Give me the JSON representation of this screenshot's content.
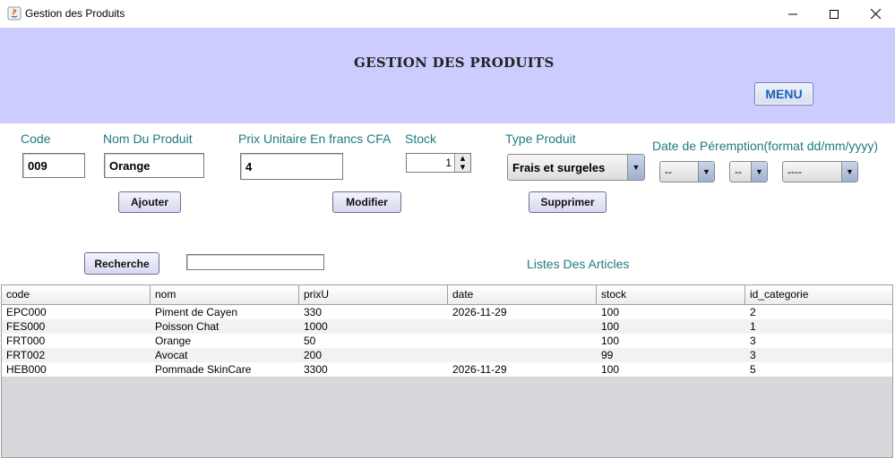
{
  "window": {
    "title": "Gestion des Produits",
    "controls": [
      "minimize",
      "maximize",
      "close"
    ]
  },
  "header": {
    "title": "GESTION DES PRODUITS",
    "menu_label": "MENU",
    "background": "#ccccff"
  },
  "form": {
    "code": {
      "label": "Code",
      "value": "009"
    },
    "nom": {
      "label": "Nom Du Produit",
      "value": "Orange"
    },
    "prix": {
      "label": "Prix Unitaire En francs CFA",
      "value": "4"
    },
    "stock": {
      "label": "Stock",
      "value": "1"
    },
    "type": {
      "label": "Type Produit",
      "selected": "Frais et surgeles"
    },
    "date": {
      "label": "Date de Péremption(format dd/mm/yyyy)",
      "day": "--",
      "month": "--",
      "year": "----"
    }
  },
  "actions": {
    "ajouter": "Ajouter",
    "modifier": "Modifier",
    "supprimer": "Supprimer",
    "recherche": "Recherche"
  },
  "search": {
    "value": ""
  },
  "list_title": "Listes Des Articles",
  "table": {
    "columns": [
      "code",
      "nom",
      "prixU",
      "date",
      "stock",
      "id_categorie"
    ],
    "rows": [
      [
        "EPC000",
        "Piment de Cayen",
        "330",
        "2026-11-29",
        "100",
        "2"
      ],
      [
        "FES000",
        "Poisson Chat",
        "1000",
        "",
        "100",
        "1"
      ],
      [
        "FRT000",
        "Orange",
        "50",
        "",
        "100",
        "3"
      ],
      [
        "FRT002",
        "Avocat",
        "200",
        "",
        "99",
        "3"
      ],
      [
        "HEB000",
        "Pommade SkinCare",
        "3300",
        "2026-11-29",
        "100",
        "5"
      ]
    ]
  },
  "colors": {
    "label_text": "#1f7a80",
    "menu_text": "#1a5fb4"
  }
}
